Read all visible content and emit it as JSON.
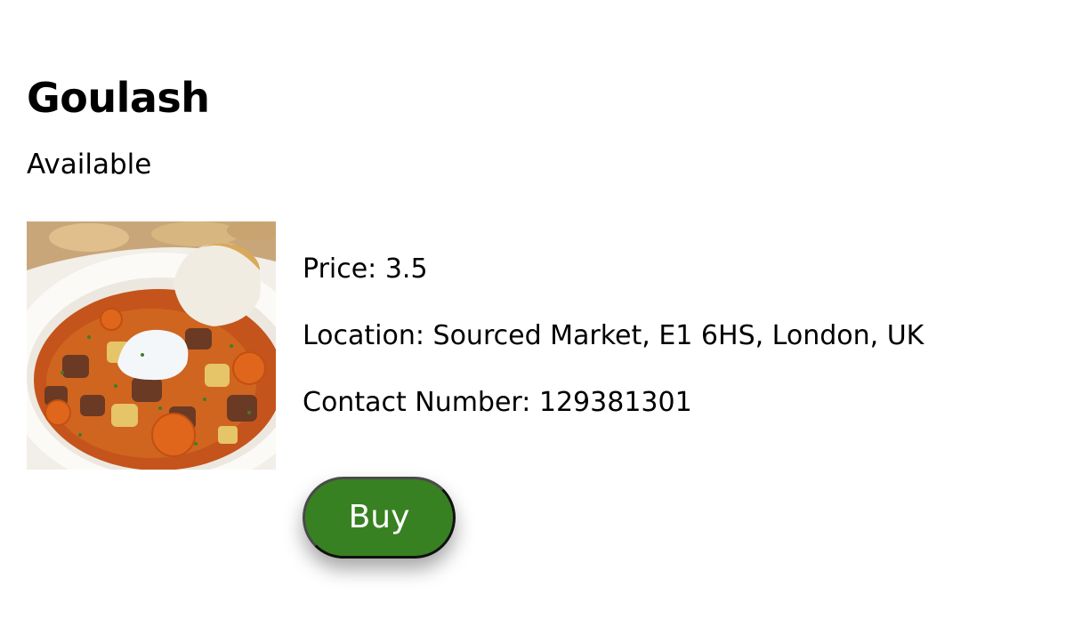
{
  "product": {
    "name": "Goulash",
    "status": "Available",
    "image_alt": "Goulash",
    "price_label": "Price: 3.5",
    "location_label": "Location: Sourced Market, E1 6HS, London, UK",
    "contact_label": "Contact Number: 129381301"
  },
  "actions": {
    "buy_label": "Buy"
  },
  "colors": {
    "buy_button": "#388122",
    "text": "#000000",
    "background": "#ffffff"
  }
}
